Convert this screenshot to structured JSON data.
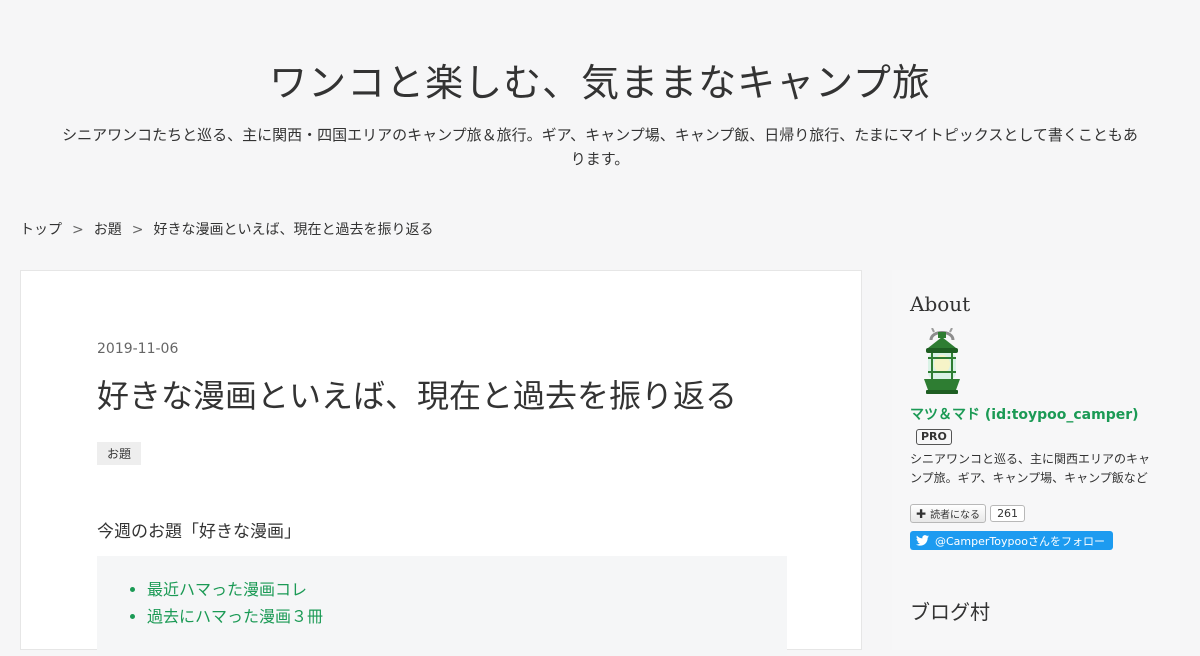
{
  "header": {
    "title": "ワンコと楽しむ、気ままなキャンプ旅",
    "description": "シニアワンコたちと巡る、主に関西・四国エリアのキャンプ旅＆旅行。ギア、キャンプ場、キャンプ飯、日帰り旅行、たまにマイトピックスとして書くこともあります。"
  },
  "breadcrumb": {
    "items": [
      "トップ",
      "お題",
      "好きな漫画といえば、現在と過去を振り返る"
    ],
    "separator": ">"
  },
  "entry": {
    "date": "2019-11-06",
    "title": "好きな漫画といえば、現在と過去を振り返る",
    "category": "お題",
    "intro": "今週のお題「好きな漫画」",
    "toc": [
      "最近ハマった漫画コレ",
      "過去にハマった漫画３冊"
    ]
  },
  "sidebar": {
    "about_title": "About",
    "profile_name": "マツ＆マド (id:toypoo_camper)",
    "pro_badge": "PRO",
    "description": "シニアワンコと巡る、主に関西エリアのキャンプ旅。ギア、キャンプ場、キャンプ飯など",
    "subscribe_label": "読者になる",
    "subscribe_count": "261",
    "twitter_follow": "@CamperToypooさんをフォロー",
    "blogmura_title": "ブログ村"
  },
  "colors": {
    "accent": "#1b9a55",
    "twitter": "#1d9bf0",
    "background": "#f6f6f7"
  },
  "icons": {
    "avatar": "lantern-avatar",
    "subscribe": "plus-icon",
    "twitter": "twitter-bird-icon"
  }
}
